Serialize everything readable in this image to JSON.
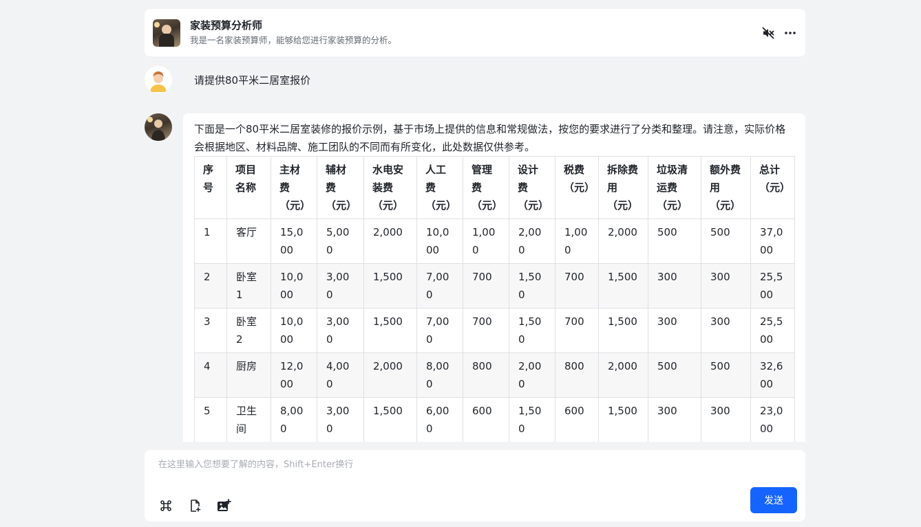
{
  "header": {
    "title": "家装预算分析师",
    "subtitle": "我是一名家装预算师，能够给您进行家装预算的分析。",
    "mute_icon": "mute-icon",
    "more_icon": "more-icon"
  },
  "user_message": "请提供80平米二居室报价",
  "bot_message": {
    "intro": "下面是一个80平米二居室装修的报价示例，基于市场上提供的信息和常规做法，按您的要求进行了分类和整理。请注意，实际价格会根据地区、材料品牌、施工团队的不同而有所变化，此处数据仅供参考。",
    "table": {
      "headers": [
        "序号",
        "项目名称",
        "主材费（元）",
        "辅材费（元）",
        "水电安装费（元）",
        "人工费（元）",
        "管理费（元）",
        "设计费（元）",
        "税费（元）",
        "拆除费用（元）",
        "垃圾清运费（元）",
        "额外费用（元）",
        "总计（元）"
      ],
      "rows": [
        [
          "1",
          "客厅",
          "15,000",
          "5,000",
          "2,000",
          "10,000",
          "1,000",
          "2,000",
          "1,000",
          "2,000",
          "500",
          "500",
          "37,000"
        ],
        [
          "2",
          "卧室1",
          "10,000",
          "3,000",
          "1,500",
          "7,000",
          "700",
          "1,500",
          "700",
          "1,500",
          "300",
          "300",
          "25,500"
        ],
        [
          "3",
          "卧室2",
          "10,000",
          "3,000",
          "1,500",
          "7,000",
          "700",
          "1,500",
          "700",
          "1,500",
          "300",
          "300",
          "25,500"
        ],
        [
          "4",
          "厨房",
          "12,000",
          "4,000",
          "2,000",
          "8,000",
          "800",
          "2,000",
          "800",
          "2,000",
          "500",
          "500",
          "32,600"
        ],
        [
          "5",
          "卫生间",
          "8,000",
          "3,000",
          "1,500",
          "6,000",
          "600",
          "1,500",
          "600",
          "1,500",
          "300",
          "300",
          "23,000"
        ]
      ]
    }
  },
  "composer": {
    "placeholder": "在这里输入您想要了解的内容，Shift+Enter换行",
    "send_label": "发送",
    "tools": [
      "command-icon",
      "file-add-icon",
      "image-add-icon"
    ]
  },
  "colors": {
    "accent": "#1664ff",
    "background": "#f2f3f5"
  }
}
